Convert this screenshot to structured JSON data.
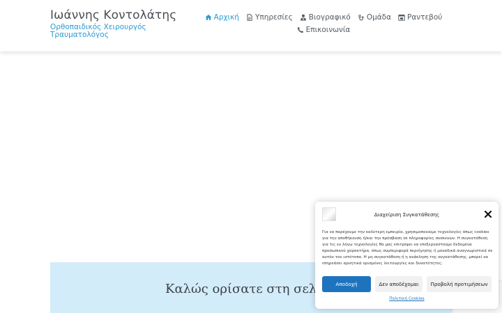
{
  "header": {
    "brand_name": "Ιωάννης Κοντολάτης",
    "brand_sub_line1": "Ορθοπαιδικός Χειρουργός",
    "brand_sub_line2": "Τραυματολόγος"
  },
  "nav": {
    "items": [
      {
        "label": "Αρχική",
        "icon": "home-icon",
        "active": true
      },
      {
        "label": "Υπηρεσίες",
        "icon": "file-icon"
      },
      {
        "label": "Βιογραφικό",
        "icon": "user-doctor-icon"
      },
      {
        "label": "Ομάδα",
        "icon": "stethoscope-icon"
      },
      {
        "label": "Ραντεβού",
        "icon": "calendar-icon"
      },
      {
        "label": "Επικοινωνία",
        "icon": "phone-icon"
      }
    ]
  },
  "banner": {
    "title": "Καλώς ορίσατε στη σελίδα μ"
  },
  "consent": {
    "title": "Διαχείριση Συγκατάθεσης",
    "text": "Για να παρέχουμε την καλύτερη εμπειρία, χρησιμοποιούμε τεχνολογίες όπως cookies για την αποθήκευση ή/και την πρόσβαση σε πληροφορίες συσκευών. Η συγκατάθεση για τις εν λόγω τεχνολογίες θα μας επιτρέψει να επεξεργαστούμε δεδομένα προσωπικού χαρακτήρα, όπως συμπεριφορά περιήγησης ή μοναδικά αναγνωριστικά σε αυτόν τον ιστότοπο. Η μη συγκατάθεση ή η ανάκληση της συγκατάθεσης, μπορεί να επηρεάσει αρνητικά ορισμένες λειτουργίες και δυνατότητες.",
    "accept_label": "Αποδοχή",
    "deny_label": "Δεν αποδέχομαι",
    "prefs_label": "Προβολή προτιμήσεων",
    "policy_link": "Πολιτική Cookies"
  },
  "colors": {
    "accent": "#2c9ad1",
    "button_primary": "#1e73be",
    "banner_bg": "#d3ecfa"
  }
}
